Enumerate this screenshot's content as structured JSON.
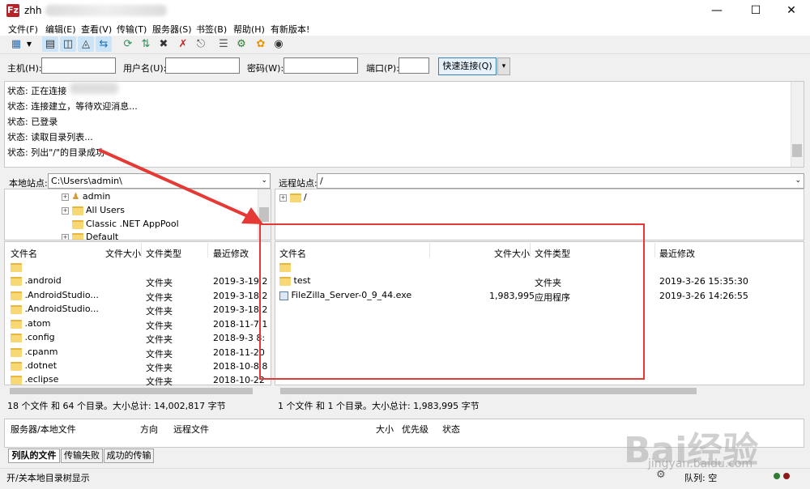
{
  "window": {
    "title": "zhh",
    "icon": "filezilla-icon"
  },
  "menu": [
    "文件(F)",
    "编辑(E)",
    "查看(V)",
    "传输(T)",
    "服务器(S)",
    "书签(B)",
    "帮助(H)",
    "有新版本!"
  ],
  "toolbar_icons": [
    "site-manager-icon",
    "dropdown-icon",
    "toggle-log-icon",
    "toggle-local-tree-icon",
    "toggle-remote-tree-icon",
    "toggle-queue-icon",
    "refresh-icon",
    "process-queue-icon",
    "cancel-icon",
    "disconnect-icon",
    "reconnect-icon",
    "filter-icon",
    "compare-icon",
    "sync-browse-icon",
    "search-icon"
  ],
  "quickconnect": {
    "host_label": "主机(H):",
    "user_label": "用户名(U):",
    "pass_label": "密码(W):",
    "port_label": "端口(P):",
    "button": "快速连接(Q)",
    "dropdown": "▾"
  },
  "log": [
    {
      "label": "状态:",
      "text": "正在连接"
    },
    {
      "label": "状态:",
      "text": "连接建立，等待欢迎消息..."
    },
    {
      "label": "状态:",
      "text": "已登录"
    },
    {
      "label": "状态:",
      "text": "读取目录列表..."
    },
    {
      "label": "状态:",
      "text": "列出\"/\"的目录成功"
    }
  ],
  "local": {
    "site_label": "本地站点:",
    "path": "C:\\Users\\admin\\",
    "tree": [
      "admin",
      "All Users",
      "Classic .NET AppPool",
      "Default"
    ],
    "columns": [
      "文件名",
      "文件大小",
      "文件类型",
      "最近修改"
    ],
    "files": [
      {
        "name": "..",
        "size": "",
        "type": "",
        "modified": ""
      },
      {
        "name": ".android",
        "size": "",
        "type": "文件夹",
        "modified": "2019-3-19 2"
      },
      {
        "name": ".AndroidStudio...",
        "size": "",
        "type": "文件夹",
        "modified": "2019-3-18 2"
      },
      {
        "name": ".AndroidStudio...",
        "size": "",
        "type": "文件夹",
        "modified": "2019-3-18 2"
      },
      {
        "name": ".atom",
        "size": "",
        "type": "文件夹",
        "modified": "2018-11-7 1"
      },
      {
        "name": ".config",
        "size": "",
        "type": "文件夹",
        "modified": "2018-9-3 8:"
      },
      {
        "name": ".cpanm",
        "size": "",
        "type": "文件夹",
        "modified": "2018-11-20"
      },
      {
        "name": ".dotnet",
        "size": "",
        "type": "文件夹",
        "modified": "2018-10-8 8"
      },
      {
        "name": ".eclipse",
        "size": "",
        "type": "文件夹",
        "modified": "2018-10-22"
      }
    ],
    "status": "18 个文件 和 64 个目录。大小总计: 14,002,817 字节"
  },
  "remote": {
    "site_label": "远程站点:",
    "path": "/",
    "tree": [
      "/"
    ],
    "columns": [
      "文件名",
      "文件大小",
      "文件类型",
      "最近修改"
    ],
    "files": [
      {
        "name": "..",
        "size": "",
        "type": "",
        "modified": ""
      },
      {
        "name": "test",
        "size": "",
        "type": "文件夹",
        "modified": "2019-3-26 15:35:30"
      },
      {
        "name": "FileZilla_Server-0_9_44.exe",
        "size": "1,983,995",
        "type": "应用程序",
        "modified": "2019-3-26 14:26:55"
      }
    ],
    "status": "1 个文件 和 1 个目录。大小总计: 1,983,995 字节"
  },
  "queue": {
    "columns": [
      "服务器/本地文件",
      "方向",
      "远程文件",
      "大小",
      "优先级",
      "状态"
    ],
    "tabs": [
      "列队的文件",
      "传输失败",
      "成功的传输"
    ],
    "active_tab": 0
  },
  "bottom": {
    "text": "开/关本地目录树显示",
    "queue_label": "队列: 空"
  },
  "watermark": {
    "line1": "Bai经验",
    "line2": "jingyan.baidu.com"
  },
  "colors": {
    "highlight": "#e53935",
    "folder": "#f8d775",
    "accent": "#3c7fb1"
  }
}
